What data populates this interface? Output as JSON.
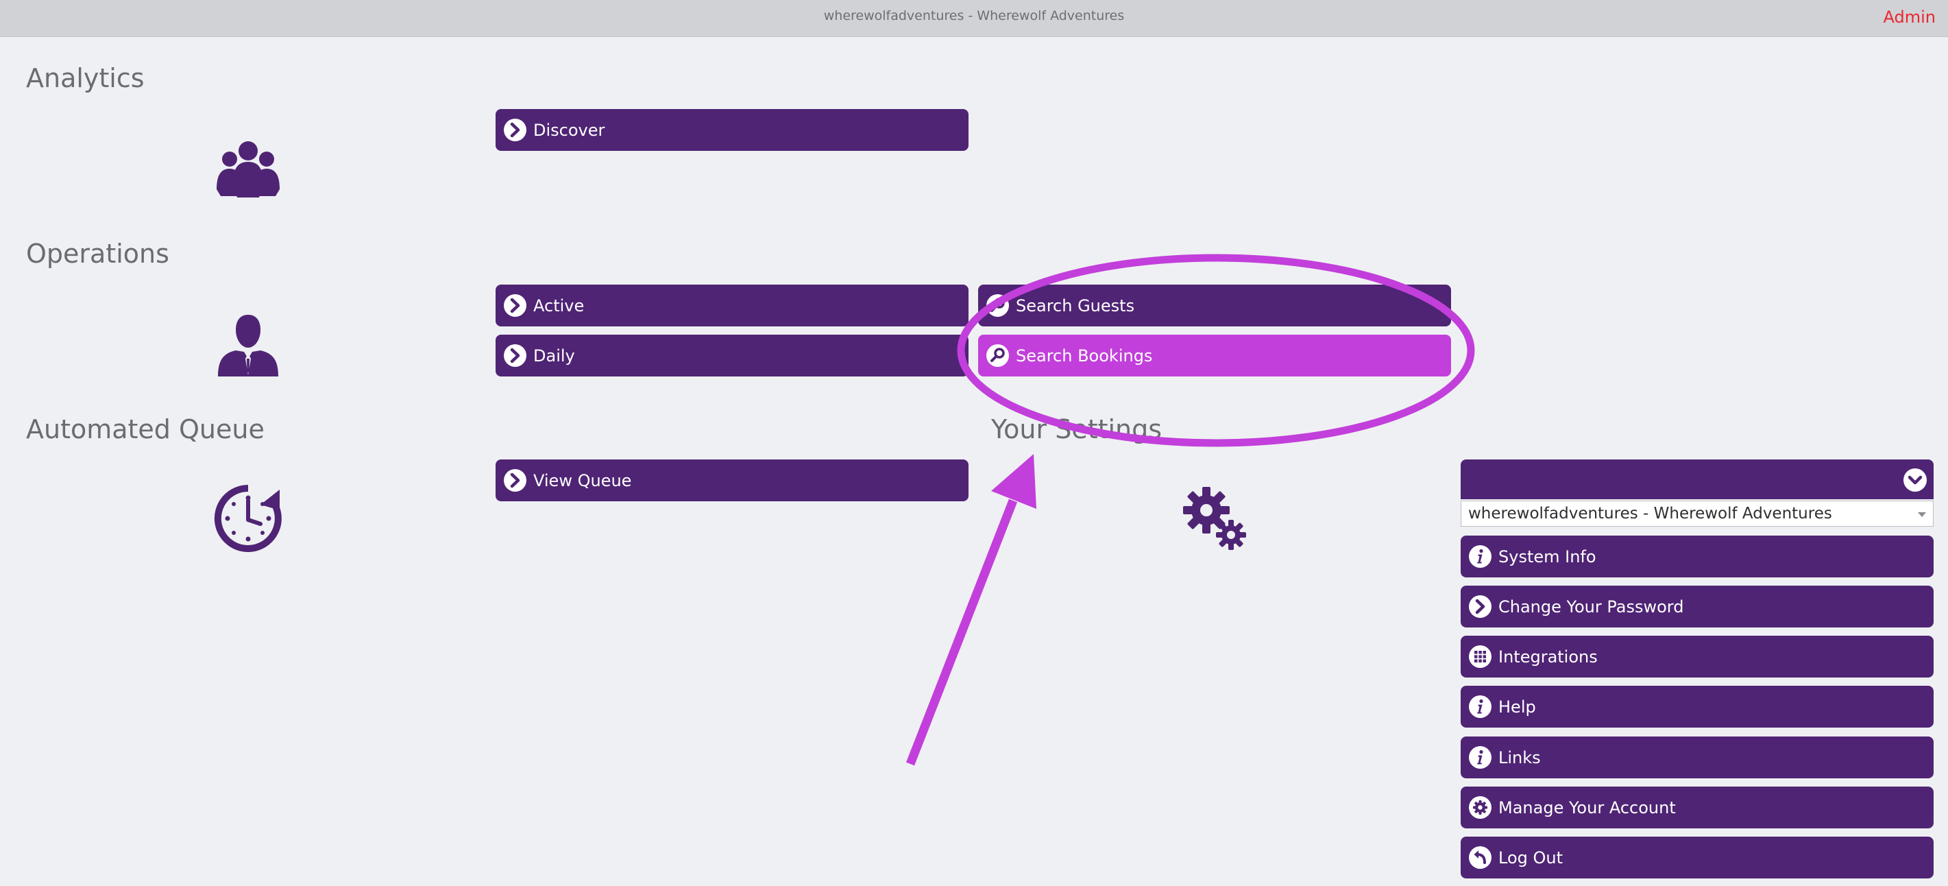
{
  "topbar": {
    "title": "wherewolfadventures - Wherewolf Adventures",
    "admin_label": "Admin"
  },
  "sections": {
    "analytics": {
      "title": "Analytics",
      "icon": "users-group-icon"
    },
    "operations": {
      "title": "Operations",
      "icon": "person-icon"
    },
    "automated_queue": {
      "title": "Automated Queue",
      "icon": "clock-history-icon"
    },
    "settings": {
      "title": "Your Settings",
      "icon": "gears-icon"
    }
  },
  "buttons": {
    "discover": "Discover",
    "active": "Active",
    "daily": "Daily",
    "search_guests": "Search Guests",
    "search_bookings": "Search Bookings",
    "view_queue": "View Queue"
  },
  "settings": {
    "account_select_value": "wherewolfadventures - Wherewolf Adventures",
    "items": [
      {
        "label": "System Info",
        "icon": "info-icon"
      },
      {
        "label": "Change Your Password",
        "icon": "chevron-right-icon"
      },
      {
        "label": "Integrations",
        "icon": "grid-icon"
      },
      {
        "label": "Help",
        "icon": "info-icon"
      },
      {
        "label": "Links",
        "icon": "info-icon"
      },
      {
        "label": "Manage Your Account",
        "icon": "gear-icon"
      },
      {
        "label": "Log Out",
        "icon": "logout-icon"
      }
    ]
  },
  "colors": {
    "primary": "#4f2474",
    "highlight": "#c23fdb",
    "annotation": "#c23fdb",
    "admin": "#e8282f"
  }
}
